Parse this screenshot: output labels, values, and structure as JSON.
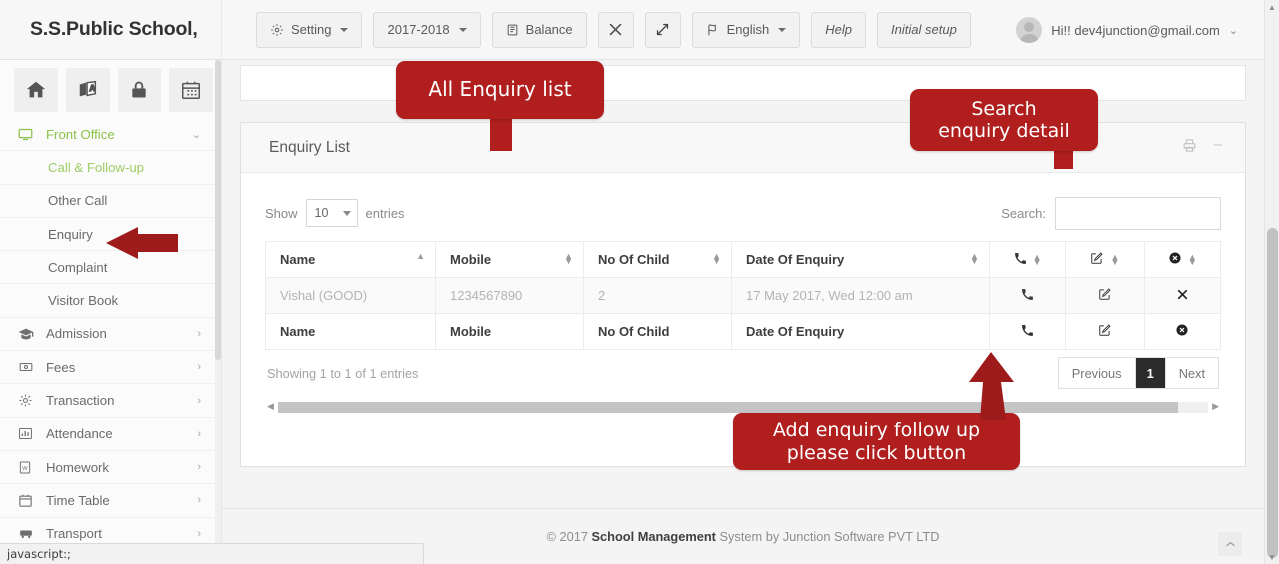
{
  "header": {
    "brand": "S.S.Public School,",
    "buttons": [
      {
        "label": "Setting",
        "icon": "gear-icon",
        "caret": true
      },
      {
        "label": "2017-2018",
        "icon": null,
        "caret": true
      },
      {
        "label": "Balance",
        "icon": "book-icon",
        "caret": false
      },
      {
        "label": "",
        "icon": "collapse-icon",
        "caret": false
      },
      {
        "label": "",
        "icon": "expand-icon",
        "caret": false
      },
      {
        "label": "English",
        "icon": "flag-icon",
        "caret": true
      },
      {
        "label": "Help",
        "icon": null,
        "caret": false
      },
      {
        "label": "Initial setup",
        "icon": null,
        "caret": false
      }
    ],
    "user_greeting": "Hi!! dev4junction@gmail.com",
    "user_caret": "⌄"
  },
  "sidebar": {
    "quick_icons": [
      "home-icon",
      "language-icon",
      "lock-icon",
      "calendar-icon"
    ],
    "items": [
      {
        "label": "Front Office",
        "icon": "monitor-icon",
        "active": true,
        "chevron": "⌄",
        "expanded": true
      },
      {
        "label": "Call & Follow-up",
        "sub": true,
        "active": true
      },
      {
        "label": "Other Call",
        "sub": true,
        "active": false
      },
      {
        "label": "Enquiry",
        "sub": true,
        "active": false
      },
      {
        "label": "Complaint",
        "sub": true,
        "active": false
      },
      {
        "label": "Visitor Book",
        "sub": true,
        "active": false
      },
      {
        "label": "Admission",
        "icon": "graduation-cap-icon",
        "chevron": "›"
      },
      {
        "label": "Fees",
        "icon": "money-icon",
        "chevron": "›"
      },
      {
        "label": "Transaction",
        "icon": "gear-icon",
        "chevron": "›"
      },
      {
        "label": "Attendance",
        "icon": "bar-chart-icon",
        "chevron": "›"
      },
      {
        "label": "Homework",
        "icon": "document-icon",
        "chevron": "›"
      },
      {
        "label": "Time Table",
        "icon": "calendar-icon",
        "chevron": "›"
      },
      {
        "label": "Transport",
        "icon": "bus-icon",
        "chevron": "›"
      }
    ]
  },
  "panel": {
    "title": "Enquiry List",
    "tools": [
      "print-icon",
      "minimize-icon"
    ]
  },
  "datatable": {
    "show_label": "Show",
    "length_value": "10",
    "entries_label": "entries",
    "search_label": "Search:",
    "search_value": "",
    "search_placeholder": "",
    "columns": [
      "Name",
      "Mobile",
      "No Of Child",
      "Date Of Enquiry",
      "call-icon",
      "edit-icon",
      "delete-icon"
    ],
    "footer_columns": [
      "Name",
      "Mobile",
      "No Of Child",
      "Date Of Enquiry",
      "call-icon",
      "edit-icon",
      "delete-icon"
    ],
    "rows": [
      {
        "name": "Vishal (GOOD)",
        "mobile": "1234567890",
        "no_of_child": "2",
        "date_of_enquiry": "17 May 2017, Wed 12:00 am",
        "call": "call-icon",
        "edit": "edit-icon",
        "delete": "close-icon"
      }
    ],
    "info": "Showing 1 to 1 of 1 entries",
    "pagination": {
      "previous": "Previous",
      "pages": [
        "1"
      ],
      "current": "1",
      "next": "Next"
    }
  },
  "footer": {
    "copyright_prefix": "© 2017 ",
    "brand": "School Management",
    "suffix": " System by Junction Software PVT LTD"
  },
  "callouts": [
    {
      "id": "all-enquiry-list",
      "text": "All Enquiry list"
    },
    {
      "id": "search-enquiry-detail",
      "line1": "Search",
      "line2": "enquiry detail"
    },
    {
      "id": "add-enquiry-follow-up",
      "line1": "Add enquiry follow up",
      "line2": "please click button"
    }
  ],
  "statusbar": {
    "text": "javascript:;"
  },
  "colors": {
    "callout_red": "#b01e1e",
    "arrow_red": "#9e1b1b",
    "active_green": "#8bc34a",
    "sub_active_green": "#9ccc65",
    "pager_current_bg": "#2b2b2b"
  },
  "gotop": {
    "icon": "chevron-up-icon"
  }
}
